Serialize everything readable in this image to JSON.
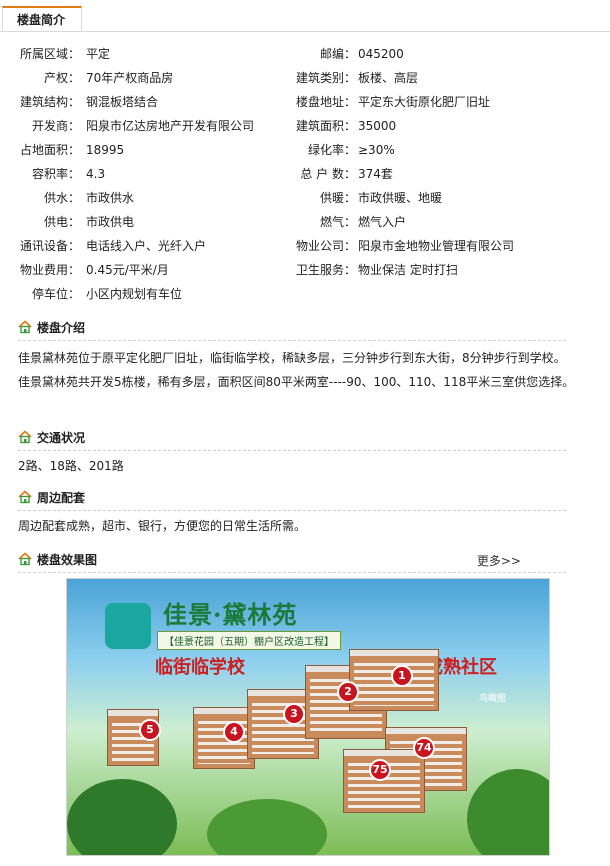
{
  "tab": {
    "label": "楼盘简介"
  },
  "info_rows": [
    {
      "l1": "所属区域：",
      "v1": "平定",
      "l2": "邮编：",
      "v2": "045200"
    },
    {
      "l1": "产权：",
      "v1": "70年产权商品房",
      "l2": "建筑类别：",
      "v2": "板楼、高层"
    },
    {
      "l1": "建筑结构：",
      "v1": "钢混板塔结合",
      "l2": "楼盘地址：",
      "v2": "平定东大街原化肥厂旧址"
    },
    {
      "l1": "开发商：",
      "v1": "阳泉市亿达房地产开发有限公司",
      "l2": "建筑面积：",
      "v2": "35000"
    },
    {
      "l1": "占地面积：",
      "v1": "18995",
      "l2": "绿化率：",
      "v2": "≥30%"
    },
    {
      "l1": "容积率：",
      "v1": "4.3",
      "l2": "总 户 数：",
      "v2": "374套"
    },
    {
      "l1": "供水：",
      "v1": "市政供水",
      "l2": "供暖：",
      "v2": "市政供暖、地暖"
    },
    {
      "l1": "供电：",
      "v1": "市政供电",
      "l2": "燃气：",
      "v2": "燃气入户"
    },
    {
      "l1": "通讯设备：",
      "v1": "电话线入户、光纤入户",
      "l2": "物业公司：",
      "v2": "阳泉市金地物业管理有限公司"
    },
    {
      "l1": "物业费用：",
      "v1": "0.45元/平米/月",
      "l2": "卫生服务：",
      "v2": "物业保洁 定时打扫"
    },
    {
      "l1": "停车位：",
      "v1": "小区内规划有车位",
      "l2": "",
      "v2": ""
    }
  ],
  "sections": {
    "intro": {
      "title": "楼盘介绍",
      "lines": [
        "佳景黛林苑位于原平定化肥厂旧址，临街临学校，稀缺多层，三分钟步行到东大街，8分钟步行到学校。",
        "佳景黛林苑共开发5栋楼，稀有多层，面积区间80平米两室----90、100、110、118平米三室供您选择。"
      ]
    },
    "traffic": {
      "title": "交通状况",
      "text": "2路、18路、201路"
    },
    "surroundings": {
      "title": "周边配套",
      "text": "周边配套成熟，超市、银行，方便您的日常生活所需。"
    },
    "renderings": {
      "title": "楼盘效果图",
      "more": "更多>>"
    }
  },
  "banner": {
    "title": "佳景·黛林苑",
    "subtitle": "【佳景花园（五期）棚户区改造工程】",
    "slogan_left": "临街临学校",
    "slogan_right": "成熟社区",
    "tag": "鸟瞰图",
    "markers": [
      "1",
      "2",
      "3",
      "4",
      "5",
      "74",
      "75"
    ]
  }
}
